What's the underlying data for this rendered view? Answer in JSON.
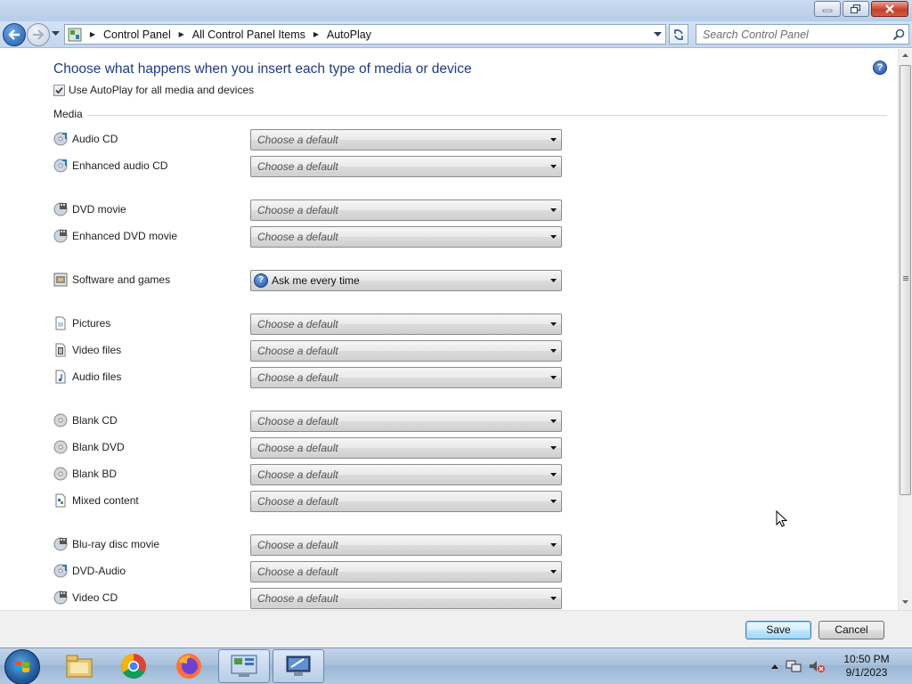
{
  "window": {
    "controls": [
      "minimize",
      "restore",
      "close"
    ]
  },
  "nav": {
    "breadcrumbs": [
      "Control Panel",
      "All Control Panel Items",
      "AutoPlay"
    ],
    "search_placeholder": "Search Control Panel"
  },
  "page": {
    "heading": "Choose what happens when you insert each type of media or device",
    "autoplay_checkbox": {
      "label": "Use AutoPlay for all media and devices",
      "checked": true
    },
    "section_label": "Media",
    "rows": [
      {
        "label": "Audio CD",
        "icon": "audio-cd-icon",
        "value": "Choose a default"
      },
      {
        "label": "Enhanced audio CD",
        "icon": "enhanced-audio-cd-icon",
        "value": "Choose a default"
      },
      {
        "label": "DVD movie",
        "icon": "dvd-movie-icon",
        "value": "Choose a default"
      },
      {
        "label": "Enhanced DVD movie",
        "icon": "enhanced-dvd-movie-icon",
        "value": "Choose a default"
      },
      {
        "label": "Software and games",
        "icon": "software-games-icon",
        "value": "Ask me every time"
      },
      {
        "label": "Pictures",
        "icon": "pictures-file-icon",
        "value": "Choose a default"
      },
      {
        "label": "Video files",
        "icon": "video-file-icon",
        "value": "Choose a default"
      },
      {
        "label": "Audio files",
        "icon": "audio-file-icon",
        "value": "Choose a default"
      },
      {
        "label": "Blank CD",
        "icon": "blank-cd-icon",
        "value": "Choose a default"
      },
      {
        "label": "Blank DVD",
        "icon": "blank-dvd-icon",
        "value": "Choose a default"
      },
      {
        "label": "Blank BD",
        "icon": "blank-bd-icon",
        "value": "Choose a default"
      },
      {
        "label": "Mixed content",
        "icon": "mixed-content-icon",
        "value": "Choose a default"
      },
      {
        "label": "Blu-ray disc movie",
        "icon": "bluray-movie-icon",
        "value": "Choose a default"
      },
      {
        "label": "DVD-Audio",
        "icon": "dvd-audio-icon",
        "value": "Choose a default"
      },
      {
        "label": "Video CD",
        "icon": "video-cd-icon",
        "value": "Choose a default"
      }
    ]
  },
  "footer": {
    "save": "Save",
    "cancel": "Cancel"
  },
  "taskbar": {
    "pinned": [
      "file-explorer-icon",
      "chrome-icon",
      "firefox-icon",
      "control-panel-icon",
      "remote-desktop-icon"
    ],
    "clock_time": "10:50 PM",
    "clock_date": "9/1/2023"
  },
  "colors": {
    "heading": "#1e3b8a",
    "titlebar": "#c9dcf1",
    "taskbar": "#a9c1dd"
  }
}
